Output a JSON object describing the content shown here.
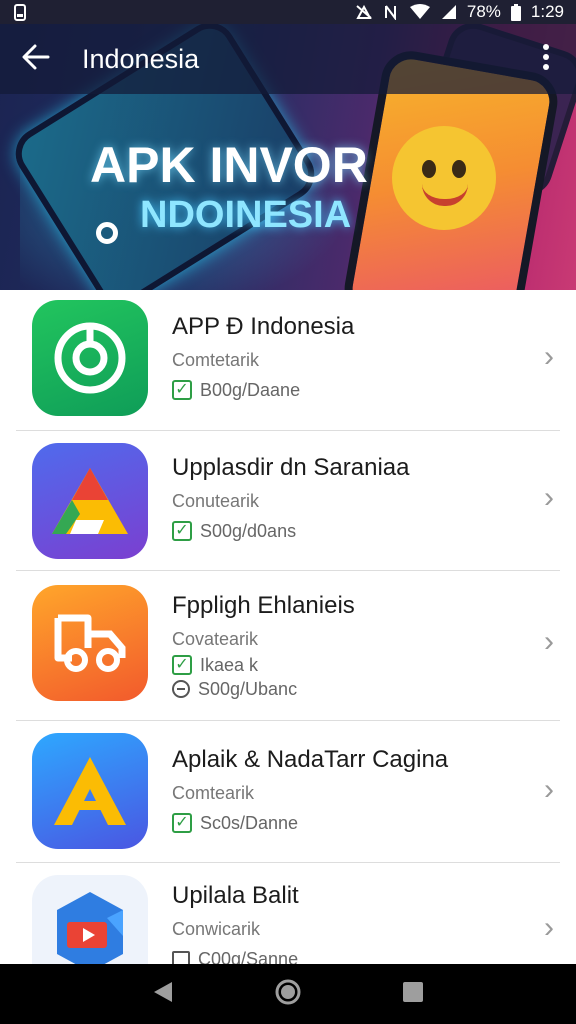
{
  "status_bar": {
    "battery_text": "78%",
    "time": "1:29",
    "icons": [
      "phone-icon",
      "notification-icon",
      "nfc-icon",
      "wifi-icon",
      "signal-icon",
      "battery-icon"
    ]
  },
  "app_bar": {
    "title": "Indonesia",
    "back_icon": "arrow-left-icon",
    "menu_icon": "more-vert-icon"
  },
  "hero": {
    "line1": "APK INVOR",
    "line2": "NDOINESIA"
  },
  "apps": [
    {
      "name": "APP Ð Indonesia",
      "subtitle": "Comtetarik",
      "meta": [
        {
          "icon": "check-icon",
          "text": "B00g/Daane"
        }
      ],
      "icon_name": "green-target-app-icon",
      "icon_color": "#1db954"
    },
    {
      "name": "Upplasdir dn Saraniaa",
      "subtitle": "Conutearik",
      "meta": [
        {
          "icon": "check-icon",
          "text": "S00g/d0ans"
        }
      ],
      "icon_name": "drive-triangle-app-icon",
      "icon_color": "#4a5fd8"
    },
    {
      "name": "Fppligh Ehlanieis",
      "subtitle": "Covatearik",
      "meta": [
        {
          "icon": "check-icon",
          "text": "Ikaea k"
        },
        {
          "icon": "clock-icon",
          "text": "S00g/Ubanc"
        }
      ],
      "icon_name": "orange-truck-app-icon",
      "icon_color": "#f57c2b"
    },
    {
      "name": "Aplaik & NadaTarr Cagina",
      "subtitle": "Comtearik",
      "meta": [
        {
          "icon": "check-icon",
          "text": "Sc0s/Danne"
        }
      ],
      "icon_name": "blue-a-app-icon",
      "icon_color": "#2f80ed"
    },
    {
      "name": "Upilala Balit",
      "subtitle": "Conwicarik",
      "meta": [
        {
          "icon": "box-icon",
          "text": "C00g/Sanne"
        }
      ],
      "icon_name": "video-app-icon",
      "icon_color": "#1e88e5"
    }
  ],
  "nav_bar": {
    "back_icon": "nav-back-icon",
    "home_icon": "nav-home-icon",
    "recents_icon": "nav-recents-icon"
  }
}
